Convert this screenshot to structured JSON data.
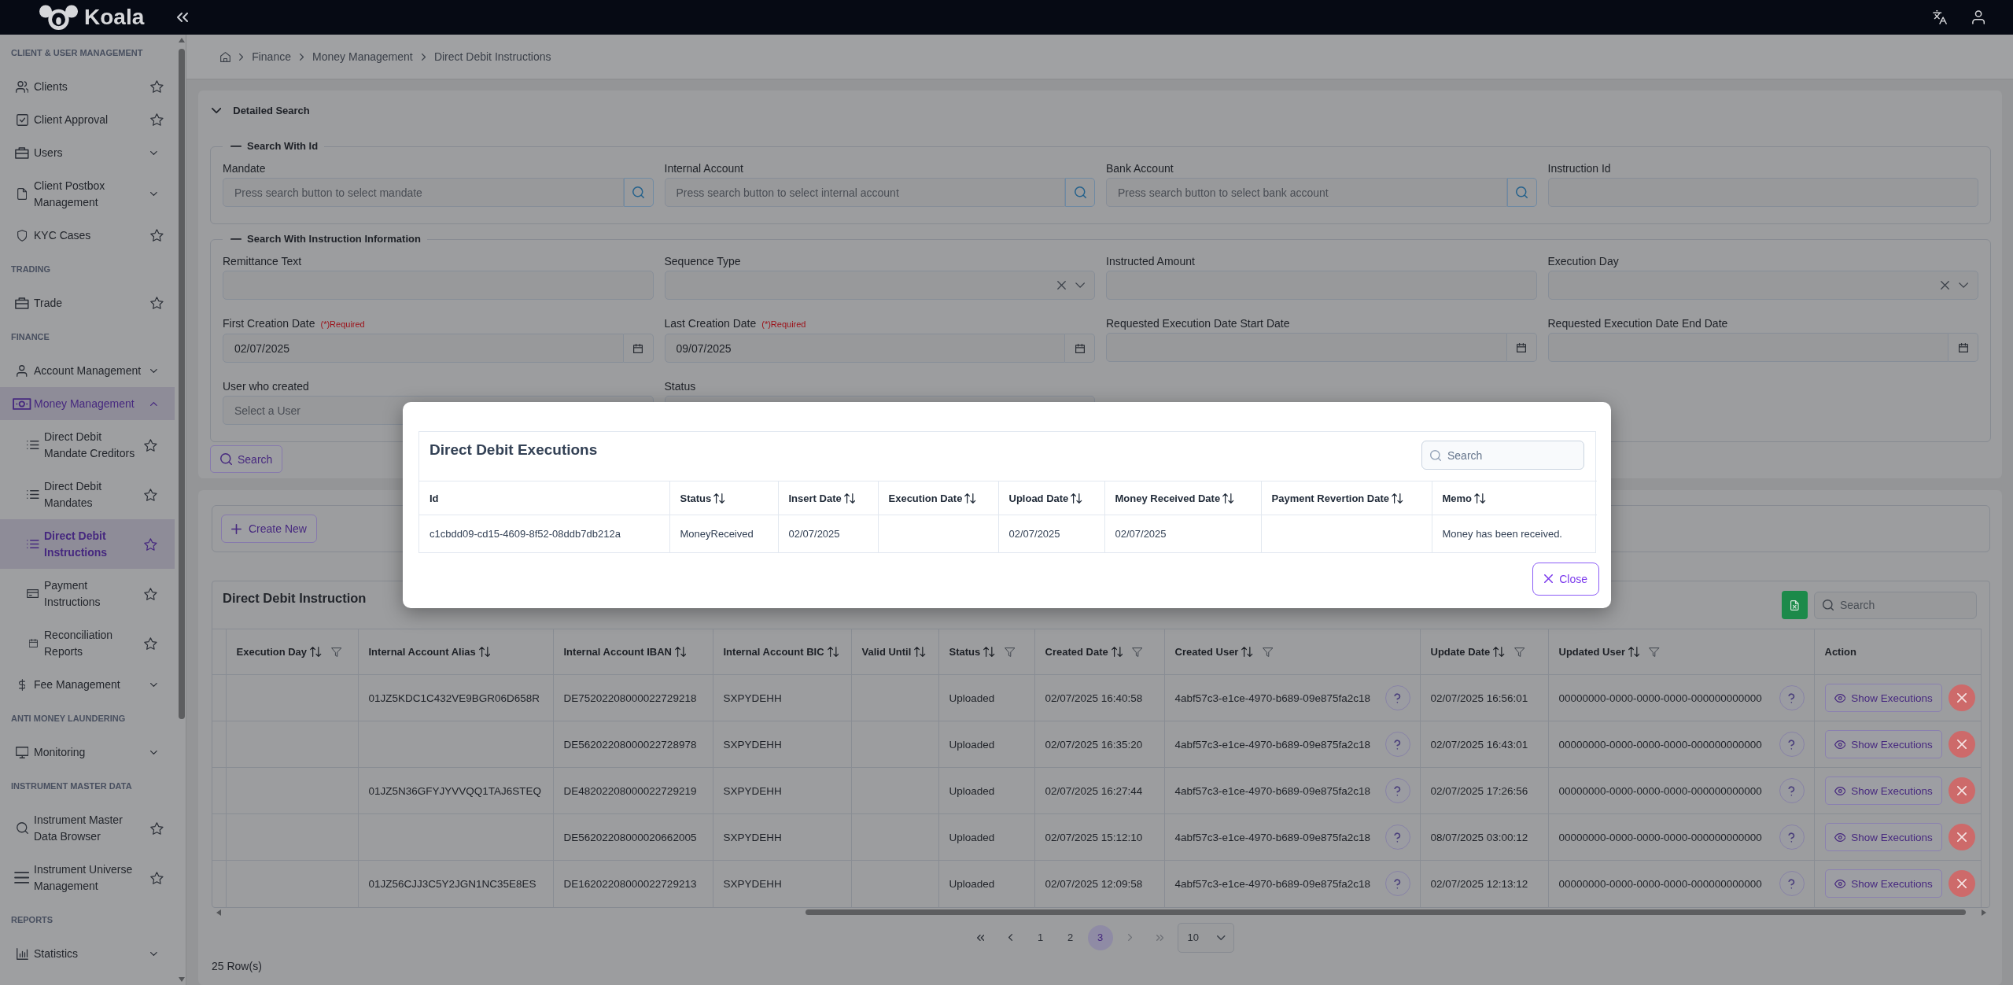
{
  "topbar": {
    "brand": "Koala"
  },
  "sidebar": {
    "sections": [
      {
        "title": "CLIENT & USER MANAGEMENT",
        "items": [
          {
            "label": "Clients",
            "kind": "link",
            "selected": false
          },
          {
            "label": "Client Approval",
            "kind": "link",
            "selected": false
          },
          {
            "label": "Users",
            "kind": "group",
            "expanded": false,
            "selected": false
          },
          {
            "label": "Client Postbox Management",
            "kind": "group",
            "expanded": false,
            "selected": false
          },
          {
            "label": "KYC Cases",
            "kind": "link",
            "selected": false
          }
        ]
      },
      {
        "title": "TRADING",
        "items": [
          {
            "label": "Trade",
            "kind": "link",
            "selected": false
          }
        ]
      },
      {
        "title": "FINANCE",
        "items": [
          {
            "label": "Account Management",
            "kind": "group",
            "expanded": false,
            "selected": false
          },
          {
            "label": "Money Management",
            "kind": "group",
            "expanded": true,
            "selected": true,
            "children": [
              {
                "label": "Direct Debit Mandate Creditors",
                "kind": "link",
                "selected": false
              },
              {
                "label": "Direct Debit Mandates",
                "kind": "link",
                "selected": false
              },
              {
                "label": "Direct Debit Instructions",
                "kind": "link",
                "selected": true
              },
              {
                "label": "Payment Instructions",
                "kind": "link",
                "selected": false
              },
              {
                "label": "Reconciliation Reports",
                "kind": "link",
                "selected": false
              }
            ]
          },
          {
            "label": "Fee Management",
            "kind": "group",
            "expanded": false,
            "selected": false
          }
        ]
      },
      {
        "title": "ANTI MONEY LAUNDERING",
        "items": [
          {
            "label": "Monitoring",
            "kind": "group",
            "expanded": false,
            "selected": false
          }
        ]
      },
      {
        "title": "INSTRUMENT MASTER DATA",
        "items": [
          {
            "label": "Instrument Master Data Browser",
            "kind": "link",
            "selected": false
          },
          {
            "label": "Instrument Universe Management",
            "kind": "link",
            "selected": false
          }
        ]
      },
      {
        "title": "REPORTS",
        "items": [
          {
            "label": "Statistics",
            "kind": "group",
            "expanded": false,
            "selected": false
          }
        ]
      }
    ]
  },
  "breadcrumb": [
    "Finance",
    "Money Management",
    "Direct Debit Instructions"
  ],
  "detailed_search": {
    "title": "Detailed Search",
    "expanded": true,
    "groups": [
      {
        "legend": "Search With Id",
        "expanded": true,
        "fields": [
          {
            "label": "Mandate",
            "kind": "lookup",
            "placeholder": "Press search button to select mandate"
          },
          {
            "label": "Internal Account",
            "kind": "lookup",
            "placeholder": "Press search button to select internal account"
          },
          {
            "label": "Bank Account",
            "kind": "lookup",
            "placeholder": "Press search button to select bank account"
          },
          {
            "label": "Instruction Id",
            "kind": "text"
          }
        ]
      },
      {
        "legend": "Search With Instruction Information",
        "expanded": true,
        "fields": [
          {
            "label": "Remittance Text",
            "kind": "text"
          },
          {
            "label": "Sequence Type",
            "kind": "select"
          },
          {
            "label": "Instructed Amount",
            "kind": "text"
          },
          {
            "label": "Execution Day",
            "kind": "select"
          },
          {
            "label": "First Creation Date",
            "required_note": "(*)Required",
            "kind": "date",
            "value": "02/07/2025"
          },
          {
            "label": "Last Creation Date",
            "required_note": "(*)Required",
            "kind": "date",
            "value": "09/07/2025"
          },
          {
            "label": "Requested Execution Date Start Date",
            "kind": "date"
          },
          {
            "label": "Requested Execution Date End Date",
            "kind": "date"
          },
          {
            "label": "User who created",
            "kind": "text",
            "placeholder": "Select a User"
          },
          {
            "label": "Status",
            "kind": "text"
          }
        ]
      }
    ],
    "search_button": "Search"
  },
  "instructions": {
    "create_button": "Create New",
    "title": "Direct Debit Instruction",
    "search": {
      "placeholder": "Search"
    },
    "columns": [
      {
        "label": "Execution Day",
        "kind": "text",
        "sortable": true,
        "filterable": true
      },
      {
        "label": "Internal Account Alias",
        "kind": "text",
        "sortable": true,
        "filterable": false
      },
      {
        "label": "Internal Account IBAN",
        "kind": "text",
        "sortable": true,
        "filterable": false
      },
      {
        "label": "Internal Account BIC",
        "kind": "text",
        "sortable": true,
        "filterable": false
      },
      {
        "label": "Valid Until",
        "kind": "text",
        "sortable": true,
        "filterable": false
      },
      {
        "label": "Status",
        "kind": "text",
        "sortable": true,
        "filterable": true
      },
      {
        "label": "Created Date",
        "kind": "text",
        "sortable": true,
        "filterable": true
      },
      {
        "label": "Created User",
        "kind": "user",
        "sortable": true,
        "filterable": true
      },
      {
        "label": "Update Date",
        "kind": "text",
        "sortable": true,
        "filterable": true
      },
      {
        "label": "Updated User",
        "kind": "user",
        "sortable": true,
        "filterable": true
      },
      {
        "label": "Action",
        "kind": "action",
        "sortable": false,
        "filterable": false
      }
    ],
    "rows": [
      [
        null,
        "01JZ5KDC1C432VE9BGR06D658R",
        "DE75202208000022729218",
        "SXPYDEHH",
        null,
        "Uploaded",
        "02/07/2025 16:40:58",
        "4abf57c3-e1ce-4970-b689-09e875fa2c18",
        "02/07/2025 16:56:01",
        "00000000-0000-0000-0000-000000000000",
        "Show Executions"
      ],
      [
        null,
        null,
        "DE56202208000022728978",
        "SXPYDEHH",
        null,
        "Uploaded",
        "02/07/2025 16:35:20",
        "4abf57c3-e1ce-4970-b689-09e875fa2c18",
        "02/07/2025 16:43:01",
        "00000000-0000-0000-0000-000000000000",
        "Show Executions"
      ],
      [
        null,
        "01JZ5N36GFYJYVVQQ1TAJ6STEQ",
        "DE48202208000022729219",
        "SXPYDEHH",
        null,
        "Uploaded",
        "02/07/2025 16:27:44",
        "4abf57c3-e1ce-4970-b689-09e875fa2c18",
        "02/07/2025 17:26:56",
        "00000000-0000-0000-0000-000000000000",
        "Show Executions"
      ],
      [
        null,
        null,
        "DE56202208000020662005",
        "SXPYDEHH",
        null,
        "Uploaded",
        "02/07/2025 15:12:10",
        "4abf57c3-e1ce-4970-b689-09e875fa2c18",
        "08/07/2025 03:00:12",
        "00000000-0000-0000-0000-000000000000",
        "Show Executions"
      ],
      [
        null,
        "01JZ56CJJ3C5Y2JGN1NC35E8ES",
        "DE16202208000022729213",
        "SXPYDEHH",
        null,
        "Uploaded",
        "02/07/2025 12:09:58",
        "4abf57c3-e1ce-4970-b689-09e875fa2c18",
        "02/07/2025 12:13:12",
        "00000000-0000-0000-0000-000000000000",
        "Show Executions"
      ]
    ],
    "pagination": {
      "first": {
        "disabled": false
      },
      "previous": {
        "disabled": false
      },
      "pages": [
        {
          "label": "1",
          "selected": false
        },
        {
          "label": "2",
          "selected": false
        },
        {
          "label": "3",
          "selected": true
        }
      ],
      "next": {
        "disabled": true
      },
      "last": {
        "disabled": true
      },
      "page_size": "10"
    },
    "row_count": "25 Row(s)"
  },
  "modal": {
    "title": "Direct Debit Executions",
    "search": {
      "placeholder": "Search"
    },
    "columns": [
      {
        "label": "Id",
        "sortable": false
      },
      {
        "label": "Status",
        "sortable": true
      },
      {
        "label": "Insert Date",
        "sortable": true
      },
      {
        "label": "Execution Date",
        "sortable": true
      },
      {
        "label": "Upload Date",
        "sortable": true
      },
      {
        "label": "Money Received Date",
        "sortable": true
      },
      {
        "label": "Payment Revertion Date",
        "sortable": true
      },
      {
        "label": "Memo",
        "sortable": true
      }
    ],
    "rows": [
      [
        "c1cbdd09-cd15-4609-8f52-08ddb7db212a",
        "MoneyReceived",
        "02/07/2025",
        null,
        "02/07/2025",
        "02/07/2025",
        null,
        "Money has been received."
      ]
    ],
    "close_button": "Close"
  }
}
